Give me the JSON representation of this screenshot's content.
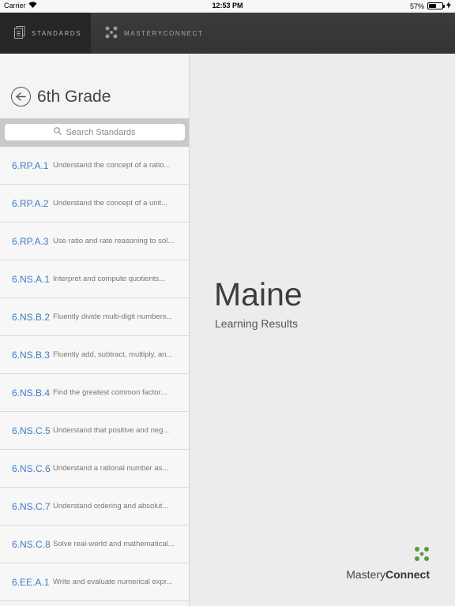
{
  "status_bar": {
    "carrier": "Carrier",
    "time": "12:53 PM",
    "battery": "57%",
    "battery_level": 0.57
  },
  "nav": {
    "tabs": [
      {
        "label": "STANDARDS",
        "icon": "document-stack-icon",
        "active": true
      },
      {
        "label": "MASTERYCONNECT",
        "icon": "masteryconnect-dots-icon",
        "active": false
      }
    ]
  },
  "sidebar": {
    "title": "6th Grade",
    "search_placeholder": "Search Standards",
    "standards": [
      {
        "code": "6.RP.A.1",
        "desc": "Understand the concept of a ratio..."
      },
      {
        "code": "6.RP.A.2",
        "desc": "Understand the concept of a unit..."
      },
      {
        "code": "6.RP.A.3",
        "desc": "Use ratio and rate reasoning to sol..."
      },
      {
        "code": "6.NS.A.1",
        "desc": "Interpret and compute quotients..."
      },
      {
        "code": "6.NS.B.2",
        "desc": "Fluently divide multi-digit numbers..."
      },
      {
        "code": "6.NS.B.3",
        "desc": "Fluently add, subtract, multiply, an..."
      },
      {
        "code": "6.NS.B.4",
        "desc": "Find the greatest common factor..."
      },
      {
        "code": "6.NS.C.5",
        "desc": "Understand that positive and neg..."
      },
      {
        "code": "6.NS.C.6",
        "desc": "Understand a rational number as..."
      },
      {
        "code": "6.NS.C.7",
        "desc": "Understand ordering and absolut..."
      },
      {
        "code": "6.NS.C.8",
        "desc": "Solve real-world and mathematical..."
      },
      {
        "code": "6.EE.A.1",
        "desc": "Write and evaluate numerical expr..."
      }
    ]
  },
  "main": {
    "state": "Maine",
    "subtitle": "Learning Results",
    "logo_part1": "Mastery",
    "logo_part2": "Connect"
  },
  "colors": {
    "accent_blue": "#3f7cc4",
    "nav_bg": "#3a3a3a",
    "logo_green": "#5a9b3c"
  }
}
